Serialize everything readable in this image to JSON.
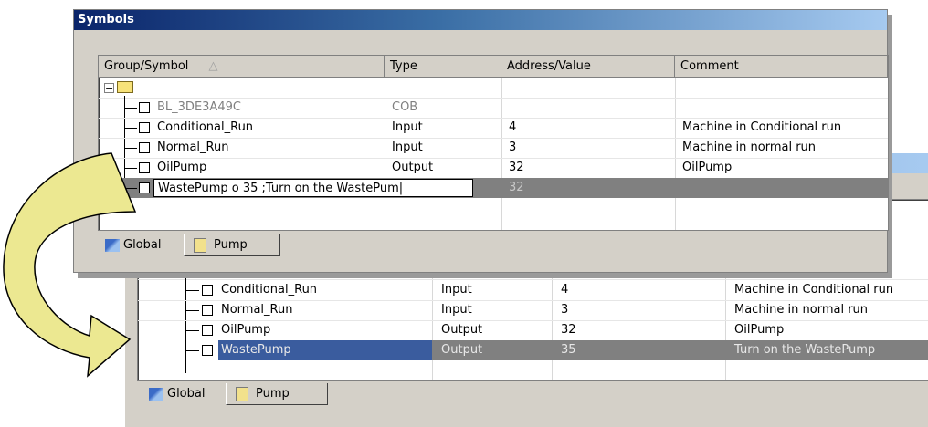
{
  "window": {
    "title": "Symbols"
  },
  "columns": {
    "group": "Group/Symbol",
    "type": "Type",
    "address": "Address/Value",
    "comment": "Comment",
    "sort": "△"
  },
  "top_rows": [
    {
      "name": "BL_3DE3A49C",
      "type": "COB",
      "address": "",
      "comment": ""
    },
    {
      "name": "Conditional_Run",
      "type": "Input",
      "address": "4",
      "comment": "Machine in Conditional run"
    },
    {
      "name": "Normal_Run",
      "type": "Input",
      "address": "3",
      "comment": "Machine in normal run"
    },
    {
      "name": "OilPump",
      "type": "Output",
      "address": "32",
      "comment": "OilPump"
    }
  ],
  "edit_row": {
    "text": "WastePump o 35 ;Turn on the WastePum|",
    "address": "32"
  },
  "bottom_rows": [
    {
      "name": "Conditional_Run",
      "type": "Input",
      "address": "4",
      "comment": "Machine in Conditional run"
    },
    {
      "name": "Normal_Run",
      "type": "Input",
      "address": "3",
      "comment": "Machine in normal run"
    },
    {
      "name": "OilPump",
      "type": "Output",
      "address": "32",
      "comment": "OilPump"
    },
    {
      "name": "WastePump",
      "type": "Output",
      "address": "35",
      "comment": "Turn on the WastePump"
    }
  ],
  "tabs": {
    "global": "Global",
    "pump": "Pump"
  },
  "arrow": {
    "fill": "#ece891",
    "stroke": "#000000"
  }
}
